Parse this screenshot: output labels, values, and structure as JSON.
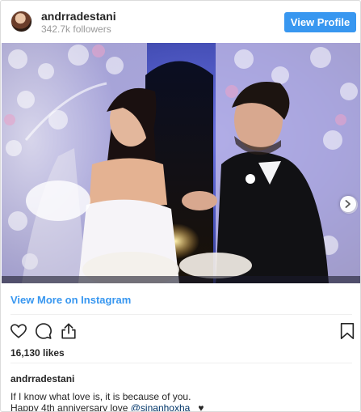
{
  "header": {
    "username": "andrradestani",
    "followers": "342.7k followers",
    "view_profile_label": "View Profile"
  },
  "links": {
    "view_more": "View More on Instagram"
  },
  "post": {
    "likes": "16,130 likes",
    "caption_username": "andrradestani",
    "caption_line1": "If I know what love is, it is because of you.",
    "caption_line2_prefix": "Happy 4th anniversary love ",
    "caption_mention": "@sinanhoxha_",
    "caption_emoji": "♥"
  },
  "icons": {
    "like": "heart-icon",
    "comment": "comment-icon",
    "share": "share-icon",
    "save": "bookmark-icon",
    "next": "chevron-right-icon"
  },
  "colors": {
    "accent": "#3897f0",
    "text": "#262626",
    "muted": "#999999",
    "mention": "#003569"
  }
}
